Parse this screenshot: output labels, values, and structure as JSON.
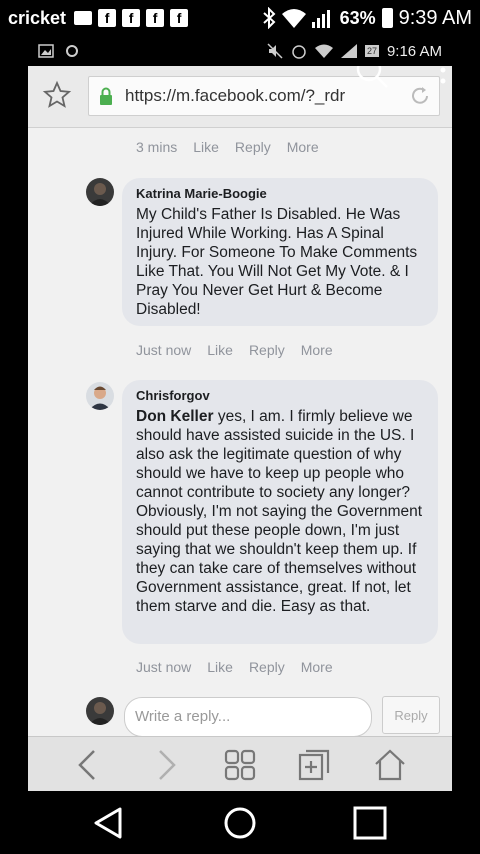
{
  "status_bar": {
    "carrier": "cricket",
    "battery": "63%",
    "time": "9:39 AM"
  },
  "inner_status_bar": {
    "time": "9:16 AM",
    "badge": "27"
  },
  "browser": {
    "url": "https://m.facebook.com/?_rdr"
  },
  "first_comment_actions": {
    "time": "3 mins",
    "like": "Like",
    "reply": "Reply",
    "more": "More"
  },
  "comments": [
    {
      "author": "Katrina Marie-Boogie",
      "mention": "",
      "text": "My Child's Father Is Disabled. He Was Injured While Working. Has A Spinal Injury. For Someone To Make Comments Like That. You Will Not Get My Vote. & I Pray You Never Get Hurt & Become Disabled!",
      "time": "Just now",
      "like": "Like",
      "reply": "Reply",
      "more": "More"
    },
    {
      "author": "Chrisforgov",
      "mention": "Don Keller",
      "text": " yes, I am. I firmly believe we should have assisted suicide in the US. I also ask the legitimate question of why should we have to keep up people who cannot contribute to society any longer? Obviously, I'm not saying the Government should put these people down, I'm just saying that we shouldn't keep them up. If they can take care of themselves without Government assistance, great. If not, let them starve and die. Easy as that.",
      "time": "Just now",
      "like": "Like",
      "reply": "Reply",
      "more": "More"
    }
  ],
  "reply_box": {
    "placeholder": "Write a reply...",
    "button": "Reply"
  },
  "icons": {
    "browser_bottom": [
      "back-icon",
      "forward-icon",
      "tabs-grid-icon",
      "add-tab-icon",
      "home-icon"
    ],
    "android_nav": [
      "nav-back-icon",
      "nav-home-icon",
      "nav-recents-icon"
    ]
  }
}
